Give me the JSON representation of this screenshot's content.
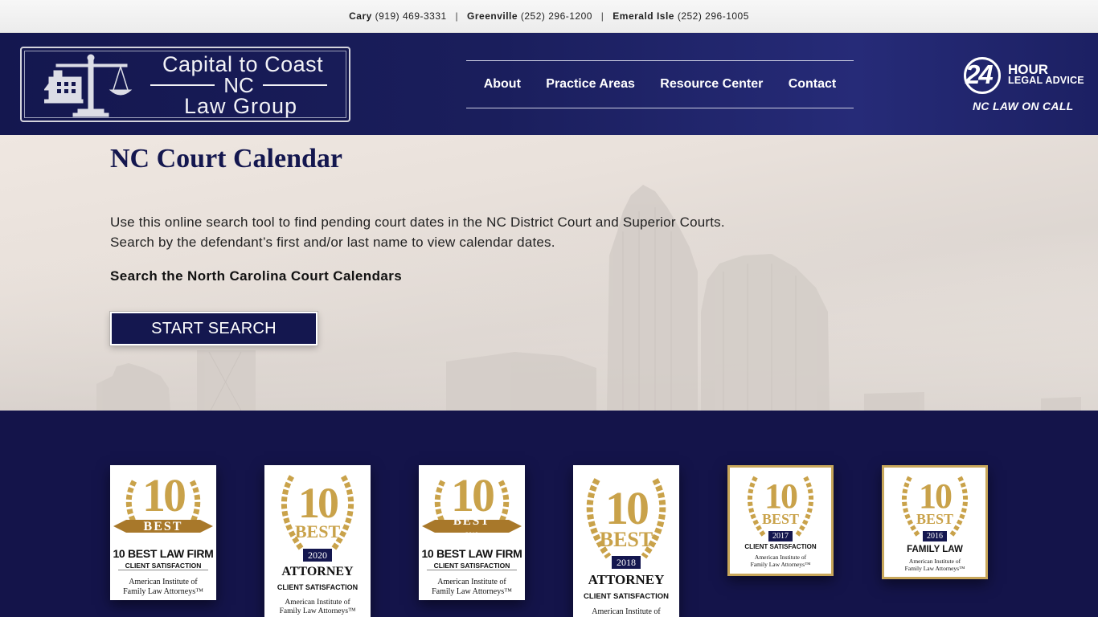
{
  "topbar": {
    "loc1_name": "Cary",
    "loc1_phone": "(919) 469-3331",
    "loc2_name": "Greenville",
    "loc2_phone": "(252) 296-1200",
    "loc3_name": "Emerald Isle",
    "loc3_phone": "(252) 296-1005",
    "separator": "|"
  },
  "logo": {
    "line1": "Capital to Coast",
    "line2": "NC",
    "line3": "Law Group"
  },
  "nav": {
    "items": [
      "About",
      "Practice Areas",
      "Resource Center",
      "Contact"
    ]
  },
  "advice": {
    "number": "24",
    "hour": "HOUR",
    "legal": "LEGAL ADVICE",
    "tagline": "NC LAW ON CALL"
  },
  "hero": {
    "title": "NC Court Calendar",
    "description": "Use this online search tool to find pending court dates in the NC District Court and Superior Courts. Search by the defendant’s first and/or last name to view calendar dates.",
    "subheading": "Search the North Carolina Court Calendars",
    "button": "START SEARCH"
  },
  "awards": [
    {
      "number": "10",
      "best": "BEST",
      "year": "",
      "title": "10 BEST LAW FIRM",
      "subtitle": "CLIENT SATISFACTION",
      "org1": "American Institute of",
      "org2": "Family Law Attorneys™"
    },
    {
      "number": "10",
      "best": "BEST",
      "year": "2020",
      "title": "ATTORNEY",
      "subtitle": "CLIENT SATISFACTION",
      "org1": "American Institute of",
      "org2": "Family Law Attorneys™"
    },
    {
      "number": "10",
      "best": "BEST",
      "year": "2019",
      "title": "10 BEST LAW FIRM",
      "subtitle": "CLIENT SATISFACTION",
      "org1": "American Institute of",
      "org2": "Family Law Attorneys™"
    },
    {
      "number": "10",
      "best": "BEST",
      "year": "2018",
      "title": "ATTORNEY",
      "subtitle": "CLIENT SATISFACTION",
      "org1": "American Institute of",
      "org2": ""
    },
    {
      "number": "10",
      "best": "BEST",
      "year": "2017",
      "title": "CLIENT SATISFACTION",
      "subtitle": "",
      "org1": "American Institute of",
      "org2": "Family Law Attorneys™"
    },
    {
      "number": "10",
      "best": "BEST",
      "year": "2016",
      "title": "FAMILY LAW",
      "subtitle": "",
      "org1": "American Institute of",
      "org2": "Family Law Attorneys™"
    }
  ],
  "colors": {
    "navy": "#14174f",
    "gold": "#c9a24a",
    "hero_bg": "#e9e1db"
  }
}
